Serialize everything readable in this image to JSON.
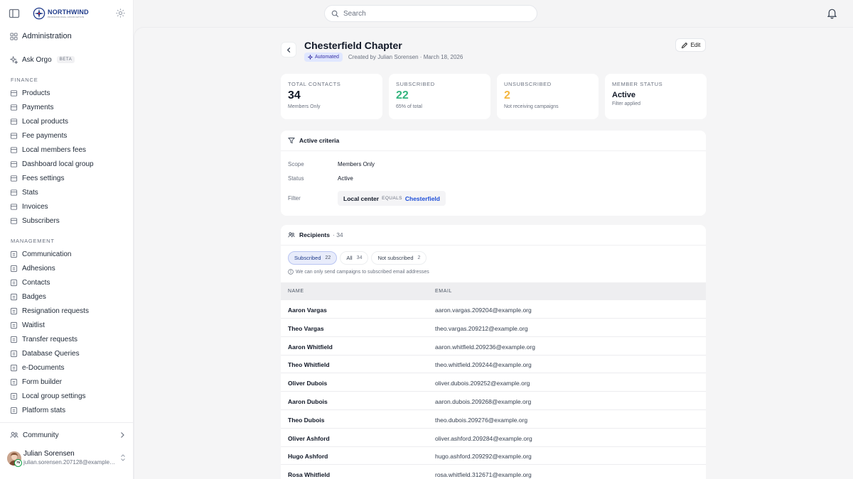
{
  "brand": {
    "name": "NORTHWIND",
    "tagline": "PROFESSIONAL ASSOCIATION"
  },
  "search": {
    "placeholder": "Search"
  },
  "sidebar": {
    "admin_label": "Administration",
    "ask_label": "Ask Orgo",
    "ask_badge": "BETA",
    "finance_title": "FINANCE",
    "finance_items": [
      {
        "label": "Products",
        "icon": "box-icon"
      },
      {
        "label": "Payments",
        "icon": "credit-card-icon"
      },
      {
        "label": "Local products",
        "icon": "list-icon"
      },
      {
        "label": "Fee payments",
        "icon": "wallet-icon"
      },
      {
        "label": "Local members fees",
        "icon": "card-icon"
      },
      {
        "label": "Dashboard local group",
        "icon": "table-icon"
      },
      {
        "label": "Fees settings",
        "icon": "gear-icon"
      },
      {
        "label": "Stats",
        "icon": "bar-chart-icon"
      },
      {
        "label": "Invoices",
        "icon": "file-icon"
      },
      {
        "label": "Subscribers",
        "icon": "file-text-icon"
      }
    ],
    "management_title": "MANAGEMENT",
    "management_items": [
      {
        "label": "Communication",
        "icon": "message-icon"
      },
      {
        "label": "Adhesions",
        "icon": "users-icon"
      },
      {
        "label": "Contacts",
        "icon": "contact-icon"
      },
      {
        "label": "Badges",
        "icon": "badge-icon"
      },
      {
        "label": "Resignation requests",
        "icon": "door-icon"
      },
      {
        "label": "Waitlist",
        "icon": "hourglass-icon"
      },
      {
        "label": "Transfer requests",
        "icon": "transfer-icon"
      },
      {
        "label": "Database Queries",
        "icon": "database-icon"
      },
      {
        "label": "e-Documents",
        "icon": "document-icon"
      },
      {
        "label": "Form builder",
        "icon": "form-icon"
      },
      {
        "label": "Local group settings",
        "icon": "settings-icon"
      },
      {
        "label": "Platform stats",
        "icon": "chart-icon"
      }
    ],
    "community_label": "Community",
    "user": {
      "name": "Julian Sorensen",
      "email": "julian.sorensen.207128@example.org",
      "badge": "75"
    }
  },
  "page": {
    "title": "Chesterfield Chapter",
    "badge": "Automated",
    "meta": "Created by Julian Sorensen · March 18, 2026",
    "edit_label": "Edit"
  },
  "stats": [
    {
      "label": "TOTAL CONTACTS",
      "value": "34",
      "note": "Members Only"
    },
    {
      "label": "SUBSCRIBED",
      "value": "22",
      "note": "65% of total"
    },
    {
      "label": "UNSUBSCRIBED",
      "value": "2",
      "note": "Not receiving campaigns"
    },
    {
      "label": "MEMBER STATUS",
      "value": "Active",
      "note": "Filter applied"
    }
  ],
  "criteria": {
    "title": "Active criteria",
    "scope_label": "Scope",
    "scope_value": "Members Only",
    "status_label": "Status",
    "status_value": "Active",
    "filter_label": "Filter",
    "filter": {
      "field": "Local center",
      "operator": "EQUALS",
      "value": "Chesterfield"
    }
  },
  "recipients": {
    "title": "Recipients",
    "count": "· 34",
    "tabs": [
      {
        "label": "Subscribed",
        "count": "22",
        "active": true
      },
      {
        "label": "All",
        "count": "34",
        "active": false
      },
      {
        "label": "Not subscribed",
        "count": "2",
        "active": false
      }
    ],
    "note": "We can only send campaigns to subscribed email addresses",
    "columns": {
      "name": "NAME",
      "email": "EMAIL"
    },
    "rows": [
      {
        "name": "Aaron Vargas",
        "email": "aaron.vargas.209204@example.org"
      },
      {
        "name": "Theo Vargas",
        "email": "theo.vargas.209212@example.org"
      },
      {
        "name": "Aaron Whitfield",
        "email": "aaron.whitfield.209236@example.org"
      },
      {
        "name": "Theo Whitfield",
        "email": "theo.whitfield.209244@example.org"
      },
      {
        "name": "Oliver Dubois",
        "email": "oliver.dubois.209252@example.org"
      },
      {
        "name": "Aaron Dubois",
        "email": "aaron.dubois.209268@example.org"
      },
      {
        "name": "Theo Dubois",
        "email": "theo.dubois.209276@example.org"
      },
      {
        "name": "Oliver Ashford",
        "email": "oliver.ashford.209284@example.org"
      },
      {
        "name": "Hugo Ashford",
        "email": "hugo.ashford.209292@example.org"
      },
      {
        "name": "Rosa Whitfield",
        "email": "rosa.whitfield.312671@example.org"
      }
    ]
  },
  "colors": {
    "accent": "#1e3a8a",
    "subscribed": "#34b57f",
    "unsubscribed": "#f4b63f",
    "filter_value": "#1d4ed8"
  }
}
